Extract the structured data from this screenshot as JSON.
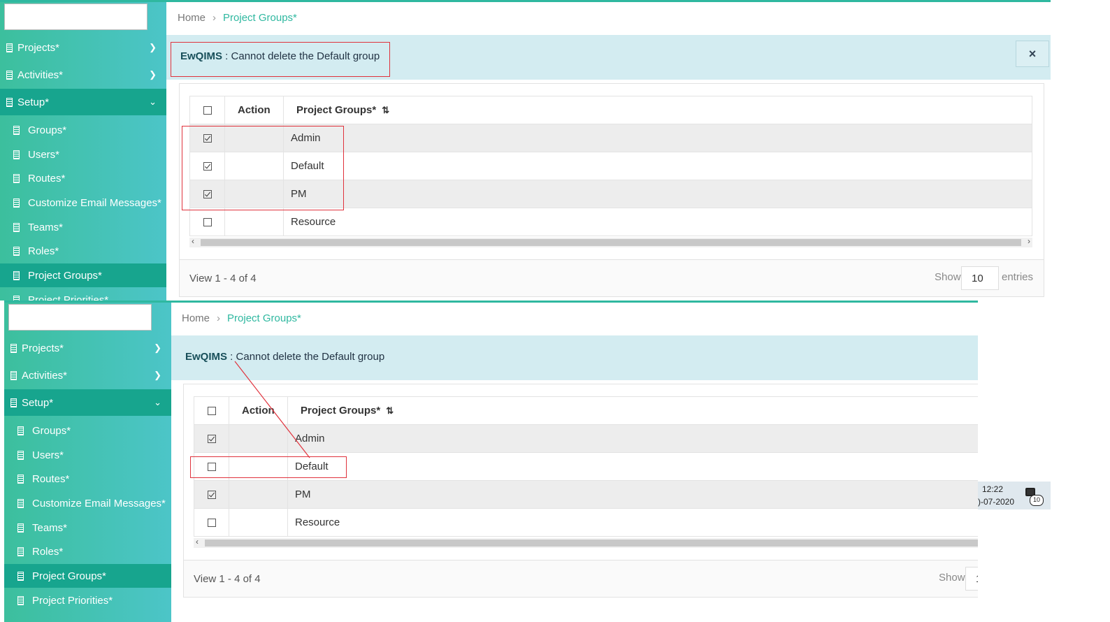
{
  "sidebar": {
    "projects": "Projects*",
    "activities": "Activities*",
    "setup": "Setup*",
    "sub_items": [
      "Groups*",
      "Users*",
      "Routes*",
      "Customize Email Messages*",
      "Teams*",
      "Roles*",
      "Project Groups*",
      "Project Priorities*"
    ]
  },
  "breadcrumb": {
    "home": "Home",
    "current": "Project Groups*"
  },
  "alert": {
    "app": "EwQIMS",
    "separator": " : ",
    "message": "Cannot delete the Default group",
    "close": "×"
  },
  "table": {
    "headers": {
      "action": "Action",
      "project_groups": "Project Groups*"
    },
    "rows_top": [
      {
        "name": "Admin",
        "checked": true
      },
      {
        "name": "Default",
        "checked": true
      },
      {
        "name": "PM",
        "checked": true
      },
      {
        "name": "Resource",
        "checked": false
      }
    ],
    "rows_bottom": [
      {
        "name": "Admin",
        "checked": true
      },
      {
        "name": "Default",
        "checked": false
      },
      {
        "name": "PM",
        "checked": true
      },
      {
        "name": "Resource",
        "checked": false
      }
    ]
  },
  "footer": {
    "view": "View 1 - 4 of 4",
    "show": "Show",
    "page_size": "10",
    "entries": "entries",
    "page_size_cut": "1"
  },
  "taskbar": {
    "time": "12:22",
    "date": ")-07-2020",
    "notif_count": "10"
  },
  "colors": {
    "accent": "#2fb8a0",
    "sidebar_active": "#17a58e",
    "alert_bg": "#d3ecf1",
    "highlight": "#e0323c"
  }
}
